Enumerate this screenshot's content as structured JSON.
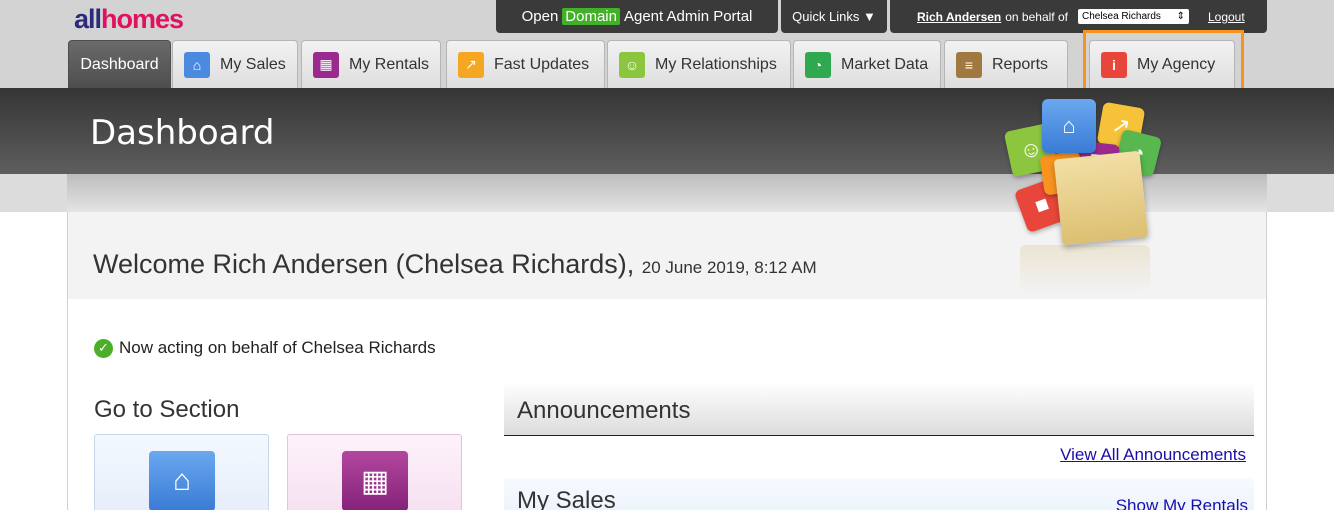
{
  "logo": {
    "part1": "all",
    "part2": "homes"
  },
  "portal": {
    "pre": "Open",
    "brand": "Domain",
    "post": "Agent Admin Portal"
  },
  "quick_links": "Quick Links ▼",
  "user": {
    "name": "Rich Andersen",
    "behalf": "on behalf of",
    "selected": "Chelsea Richards",
    "logout": "Logout"
  },
  "tabs": [
    {
      "label": "Dashboard",
      "icon": "dashboard",
      "active": true
    },
    {
      "label": "My Sales",
      "icon": "house-icon",
      "color": "#4a8be0"
    },
    {
      "label": "My Rentals",
      "icon": "building-icon",
      "color": "#9b2a8f"
    },
    {
      "label": "Fast Updates",
      "icon": "arrow-icon",
      "color": "#f5a623"
    },
    {
      "label": "My Relationships",
      "icon": "people-icon",
      "color": "#8cc63f"
    },
    {
      "label": "Market Data",
      "icon": "pie-icon",
      "color": "#2fa84f"
    },
    {
      "label": "Reports",
      "icon": "report-icon",
      "color": "#a07840"
    },
    {
      "label": "My Agency",
      "icon": "info-icon",
      "color": "#e8463a"
    }
  ],
  "header": {
    "title": "Dashboard"
  },
  "welcome": {
    "text": "Welcome Rich Andersen (Chelsea Richards),",
    "date": "20 June 2019, 8:12 AM"
  },
  "notice": "Now acting on behalf of Chelsea Richards",
  "goto": {
    "title": "Go to Section"
  },
  "announcements": {
    "title": "Announcements",
    "view_all": "View All Announcements"
  },
  "my_sales": {
    "title": "My Sales",
    "show_rentals": "Show My Rentals"
  }
}
